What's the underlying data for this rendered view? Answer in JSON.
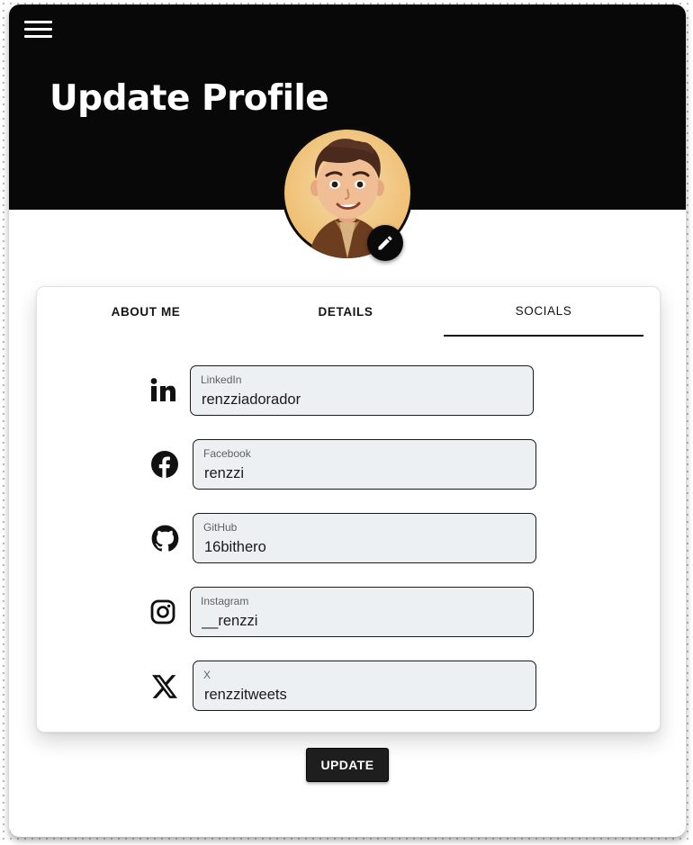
{
  "header": {
    "title": "Update Profile",
    "menu_icon": "hamburger-menu-icon",
    "background": "#080808"
  },
  "avatar": {
    "icon": "memoji-avatar",
    "edit_icon": "pencil-icon"
  },
  "tabs": [
    {
      "label": "ABOUT ME",
      "active": false
    },
    {
      "label": "DETAILS",
      "active": false
    },
    {
      "label": "SOCIALS",
      "active": true
    }
  ],
  "socials": [
    {
      "icon": "linkedin-icon",
      "label": "LinkedIn",
      "value": "renzziadorador"
    },
    {
      "icon": "facebook-icon",
      "label": "Facebook",
      "value": "renzzi"
    },
    {
      "icon": "github-icon",
      "label": "GitHub",
      "value": "16bithero"
    },
    {
      "icon": "instagram-icon",
      "label": "Instagram",
      "value": "__renzzi"
    },
    {
      "icon": "x-icon",
      "label": "X",
      "value": "renzzitweets"
    }
  ],
  "actions": {
    "update_label": "UPDATE"
  },
  "colors": {
    "field_bg": "#edf0f3",
    "button_bg": "#1e1e1e"
  }
}
